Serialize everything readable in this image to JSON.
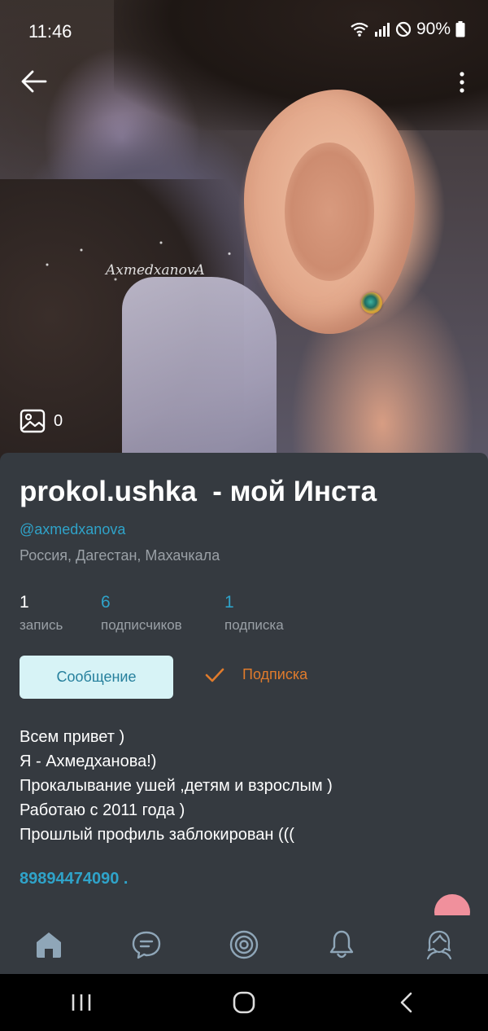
{
  "status": {
    "time": "11:46",
    "battery": "90%"
  },
  "hero": {
    "watermark": "AxmedxanovA",
    "photo_count": "0"
  },
  "profile": {
    "title": "prokol.ushka  - мой Инста",
    "handle": "@axmedxanova",
    "location": "Россия, Дагестан, Махачкала",
    "stats": [
      {
        "value": "1",
        "label": "запись"
      },
      {
        "value": "6",
        "label": "подписчиков"
      },
      {
        "value": "1",
        "label": "подписка"
      }
    ],
    "message_button": "Сообщение",
    "follow_button": "Подписка",
    "bio": [
      "Всем привет )",
      "Я - Ахмедханова!)",
      "Прокалывание ушей ,детям и взрослым )",
      "Работаю с 2011 года )",
      "Прошлый профиль заблокирован ((("
    ],
    "phone": "89894474090 ."
  },
  "colors": {
    "accent": "#2fa3c9",
    "follow": "#e07b2c",
    "panel": "#353a40",
    "fab": "#f0909c"
  },
  "nav": [
    "home-icon",
    "chat-icon",
    "target-icon",
    "bell-icon",
    "profile-icon"
  ]
}
